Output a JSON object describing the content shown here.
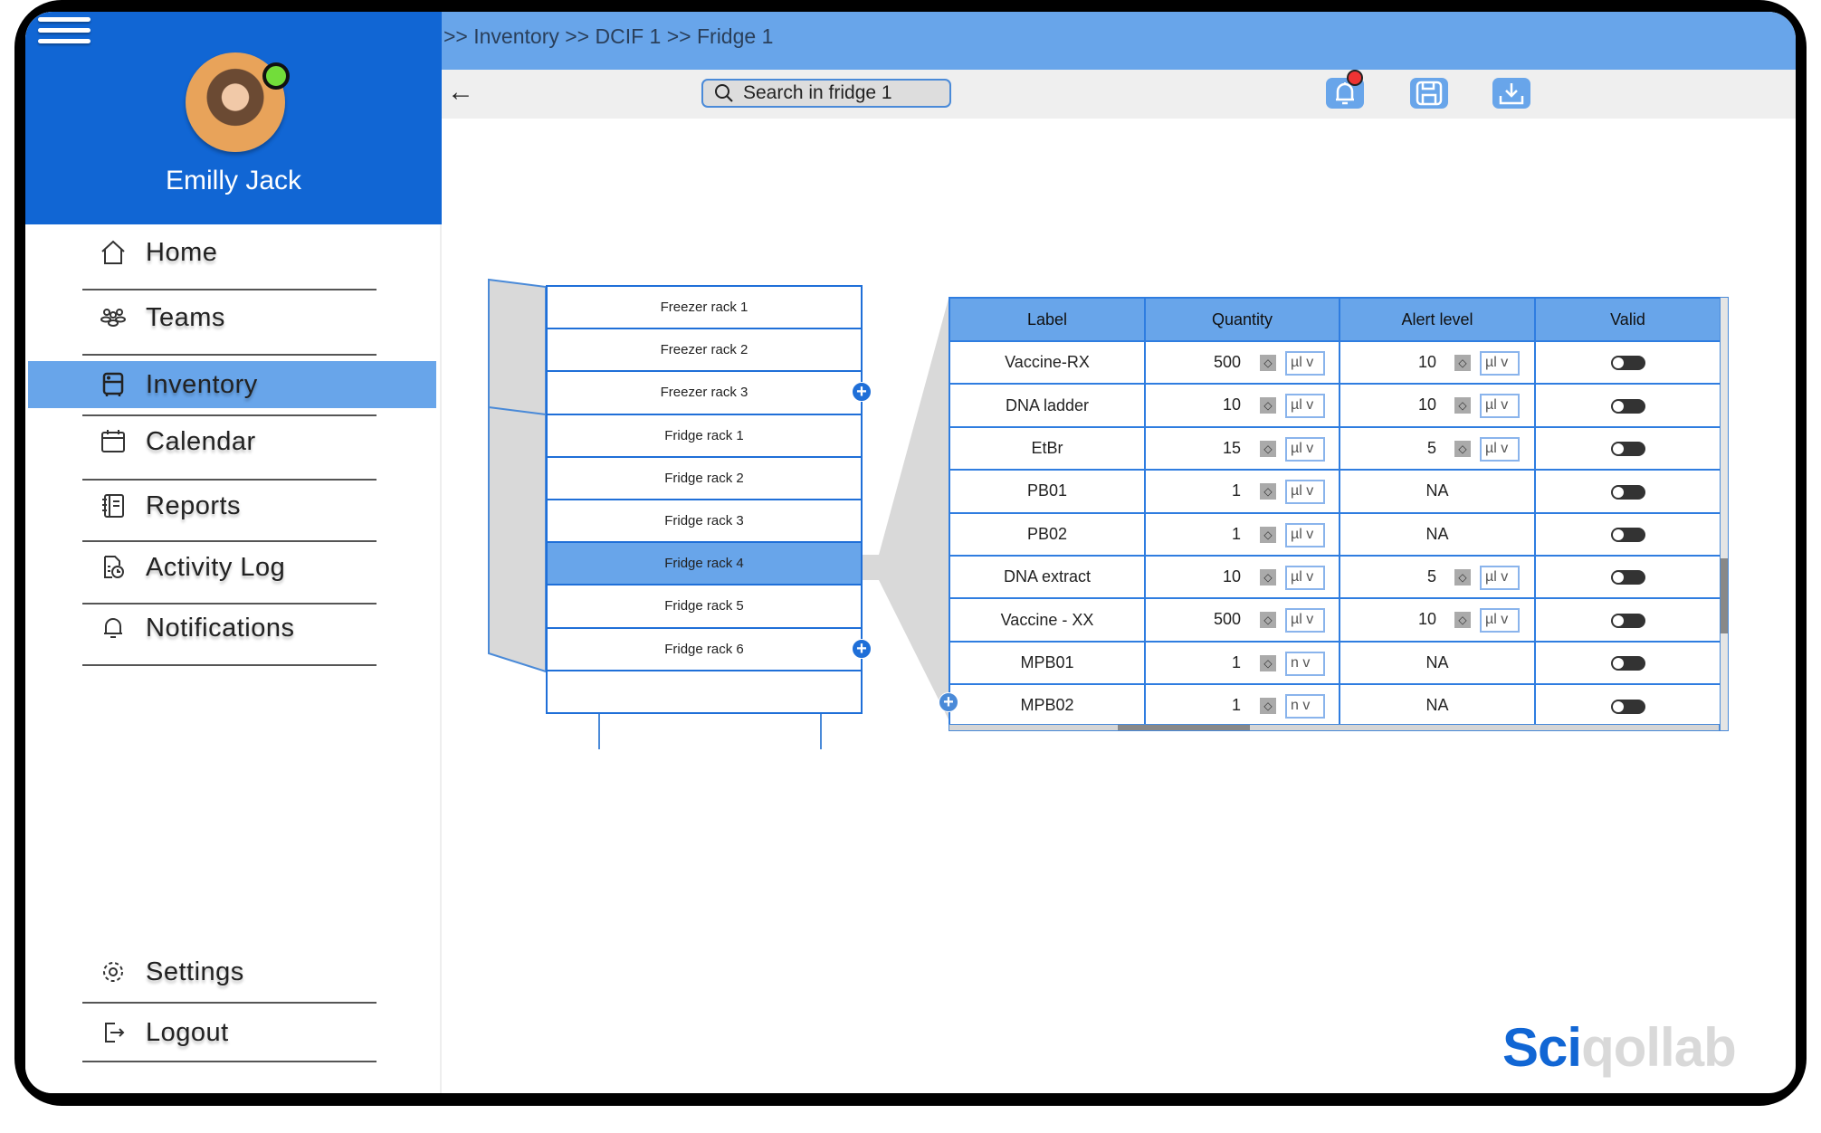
{
  "user": {
    "name": "Emilly Jack",
    "status": "online"
  },
  "sidebar": {
    "items": [
      {
        "label": "Home",
        "icon": "home-icon"
      },
      {
        "label": "Teams",
        "icon": "teams-icon"
      },
      {
        "label": "Inventory",
        "icon": "fridge-icon",
        "active": true
      },
      {
        "label": "Calendar",
        "icon": "calendar-icon"
      },
      {
        "label": "Reports",
        "icon": "reports-icon"
      },
      {
        "label": "Activity Log",
        "icon": "activity-log-icon"
      },
      {
        "label": "Notifications",
        "icon": "bell-icon"
      }
    ],
    "bottom": [
      {
        "label": "Settings",
        "icon": "gear-icon"
      },
      {
        "label": "Logout",
        "icon": "logout-icon"
      }
    ]
  },
  "breadcrumb": ">> Inventory >> DCIF 1 >> Fridge 1",
  "search": {
    "placeholder": "Search in fridge 1"
  },
  "colors": {
    "primary": "#1166D4",
    "accent": "#68A5EA",
    "notification": "#E33333",
    "online": "#72DD3A"
  },
  "racks": [
    "Freezer rack 1",
    "Freezer rack 2",
    "Freezer rack 3",
    "Fridge rack 1",
    "Fridge rack 2",
    "Fridge rack 3",
    "Fridge rack 4",
    "Fridge rack 5",
    "Fridge rack 6",
    ""
  ],
  "selected_rack": "Fridge rack 4",
  "table": {
    "headers": [
      "Label",
      "Quantity",
      "Alert level",
      "Valid"
    ],
    "rows": [
      {
        "label": "Vaccine-RX",
        "qty": "500",
        "qty_unit": "µl v",
        "alert": "10",
        "alert_unit": "µl v",
        "valid": false
      },
      {
        "label": "DNA ladder",
        "qty": "10",
        "qty_unit": "µl v",
        "alert": "10",
        "alert_unit": "µl v",
        "valid": false
      },
      {
        "label": "EtBr",
        "qty": "15",
        "qty_unit": "µl v",
        "alert": "5",
        "alert_unit": "µl v",
        "valid": false
      },
      {
        "label": "PB01",
        "qty": "1",
        "qty_unit": "µl v",
        "alert": "NA",
        "alert_unit": null,
        "valid": false
      },
      {
        "label": "PB02",
        "qty": "1",
        "qty_unit": "µl v",
        "alert": "NA",
        "alert_unit": null,
        "valid": false
      },
      {
        "label": "DNA extract",
        "qty": "10",
        "qty_unit": "µl v",
        "alert": "5",
        "alert_unit": "µl v",
        "valid": false
      },
      {
        "label": "Vaccine - XX",
        "qty": "500",
        "qty_unit": "µl v",
        "alert": "10",
        "alert_unit": "µl v",
        "valid": false
      },
      {
        "label": "MPB01",
        "qty": "1",
        "qty_unit": "n v",
        "alert": "NA",
        "alert_unit": null,
        "valid": false
      },
      {
        "label": "MPB02",
        "qty": "1",
        "qty_unit": "n v",
        "alert": "NA",
        "alert_unit": null,
        "valid": false
      }
    ]
  },
  "logo": {
    "part1": "Sci",
    "part2": "qollab"
  }
}
